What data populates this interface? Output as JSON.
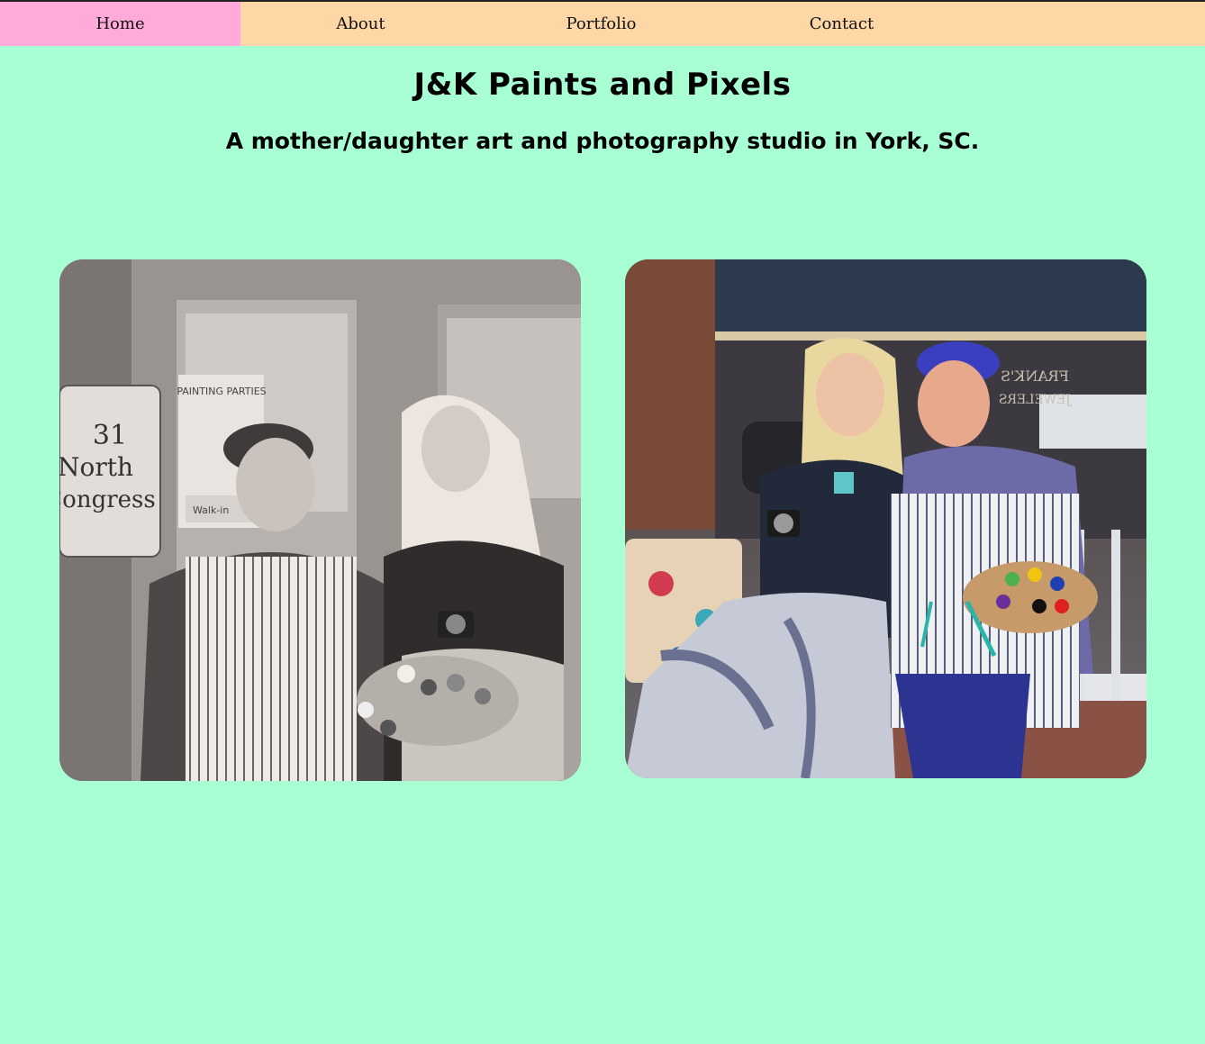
{
  "nav": {
    "items": [
      {
        "label": "Home",
        "active": true
      },
      {
        "label": "About",
        "active": false
      },
      {
        "label": "Portfolio",
        "active": false
      },
      {
        "label": "Contact",
        "active": false
      }
    ]
  },
  "header": {
    "title": "J&K Paints and Pixels",
    "subtitle": "A mother/daughter art and photography studio in York, SC."
  },
  "photos": {
    "left": {
      "sign_line1": "31",
      "sign_line2": "North",
      "sign_line3": "Congress",
      "poster_title": "PAINTING PARTIES",
      "poster_footer": "Walk-in"
    },
    "right": {
      "window_text1": "FRANK'S",
      "window_text2": "JEWELERS"
    }
  },
  "colors": {
    "background": "#a8ffd4",
    "nav_background": "#ffd6a5",
    "nav_active": "#ffaad8",
    "text": "#000000"
  }
}
